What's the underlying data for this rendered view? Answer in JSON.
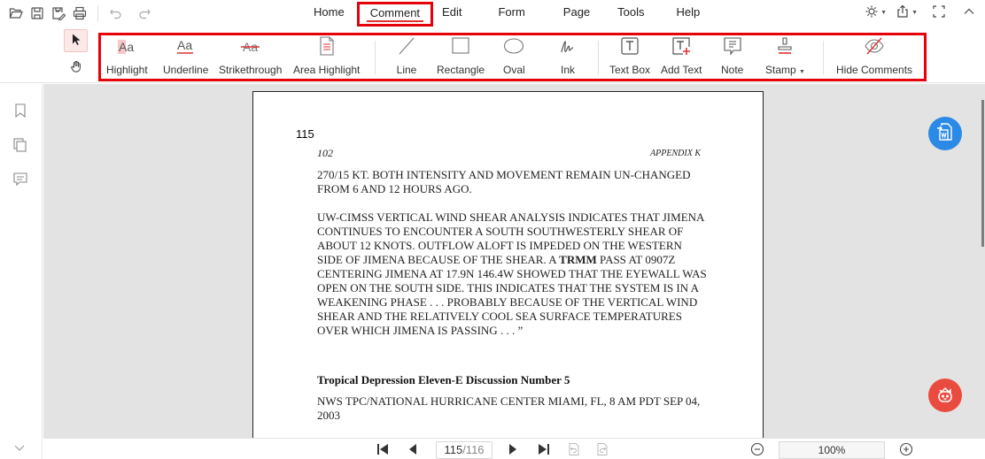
{
  "quick_access": {
    "open": "open-icon",
    "save": "save-icon",
    "save_as": "save-as-icon",
    "print": "print-icon",
    "undo": "undo-icon",
    "redo": "redo-icon"
  },
  "menu": {
    "items": [
      {
        "label": "Home",
        "active": false
      },
      {
        "label": "Comment",
        "active": true
      },
      {
        "label": "Edit",
        "active": false
      },
      {
        "label": "Form",
        "active": false
      },
      {
        "label": "Page",
        "active": false
      },
      {
        "label": "Tools",
        "active": false
      },
      {
        "label": "Help",
        "active": false
      }
    ]
  },
  "top_right": {
    "theme": "theme-icon",
    "share": "share-icon",
    "fullscreen": "fullscreen-icon",
    "collapse": "chevron-up-icon"
  },
  "ribbon": {
    "modes": [
      "Select",
      "Hand"
    ],
    "tools": [
      {
        "label": "Highlight",
        "icon": "highlight-icon"
      },
      {
        "label": "Underline",
        "icon": "underline-icon"
      },
      {
        "label": "Strikethrough",
        "icon": "strikethrough-icon"
      },
      {
        "label": "Area Highlight",
        "icon": "area-highlight-icon"
      },
      {
        "label": "Line",
        "icon": "line-icon"
      },
      {
        "label": "Rectangle",
        "icon": "rectangle-icon"
      },
      {
        "label": "Oval",
        "icon": "oval-icon"
      },
      {
        "label": "Ink",
        "icon": "ink-icon"
      },
      {
        "label": "Text Box",
        "icon": "text-box-icon"
      },
      {
        "label": "Add Text",
        "icon": "add-text-icon"
      },
      {
        "label": "Note",
        "icon": "note-icon"
      },
      {
        "label": "Stamp",
        "icon": "stamp-icon"
      },
      {
        "label": "Hide Comments",
        "icon": "hide-comments-icon"
      }
    ]
  },
  "sidebar": {
    "items": [
      "bookmark-icon",
      "pages-icon",
      "comments-icon"
    ]
  },
  "document": {
    "page_label": "115",
    "header_left": "102",
    "header_right": "APPENDIX K",
    "para1": "270/15 KT. BOTH INTENSITY AND MOVEMENT REMAIN UN-CHANGED FROM 6 AND 12 HOURS AGO.",
    "para2_before": "UW-CIMSS VERTICAL WIND SHEAR ANALYSIS INDICATES THAT JIMENA CONTINUES TO ENCOUNTER A SOUTH SOUTHWESTERLY SHEAR OF ABOUT 12 KNOTS. OUTFLOW ALOFT IS IMPEDED ON THE WESTERN SIDE OF JIMENA BECAUSE OF THE SHEAR. A ",
    "para2_bold": "TRMM",
    "para2_after": " PASS AT 0907Z CENTERING JIMENA AT 17.9N 146.4W SHOWED THAT THE EYEWALL WAS OPEN ON THE SOUTH SIDE. THIS INDICATES THAT THE SYSTEM IS IN A WEAKENING PHASE . . . PROBABLY BECAUSE OF THE VERTICAL WIND SHEAR AND THE RELATIVELY COOL SEA SURFACE TEMPERATURES OVER WHICH JIMENA IS PASSING . . . ”",
    "heading": "Tropical Depression Eleven-E Discussion Number 5",
    "para3": "NWS TPC/NATIONAL HURRICANE CENTER MIAMI, FL, 8 AM PDT SEP 04, 2003"
  },
  "floating": {
    "convert_word": "pdf-to-word-icon",
    "ai_assistant": "ai-assistant-icon"
  },
  "statusbar": {
    "current_page": "115",
    "total_pages": "/116",
    "zoom": "100%"
  },
  "colors": {
    "highlight_red": "#e6000a",
    "accent_blue": "#2b8ae6",
    "ai_red": "#ea4b3f"
  }
}
